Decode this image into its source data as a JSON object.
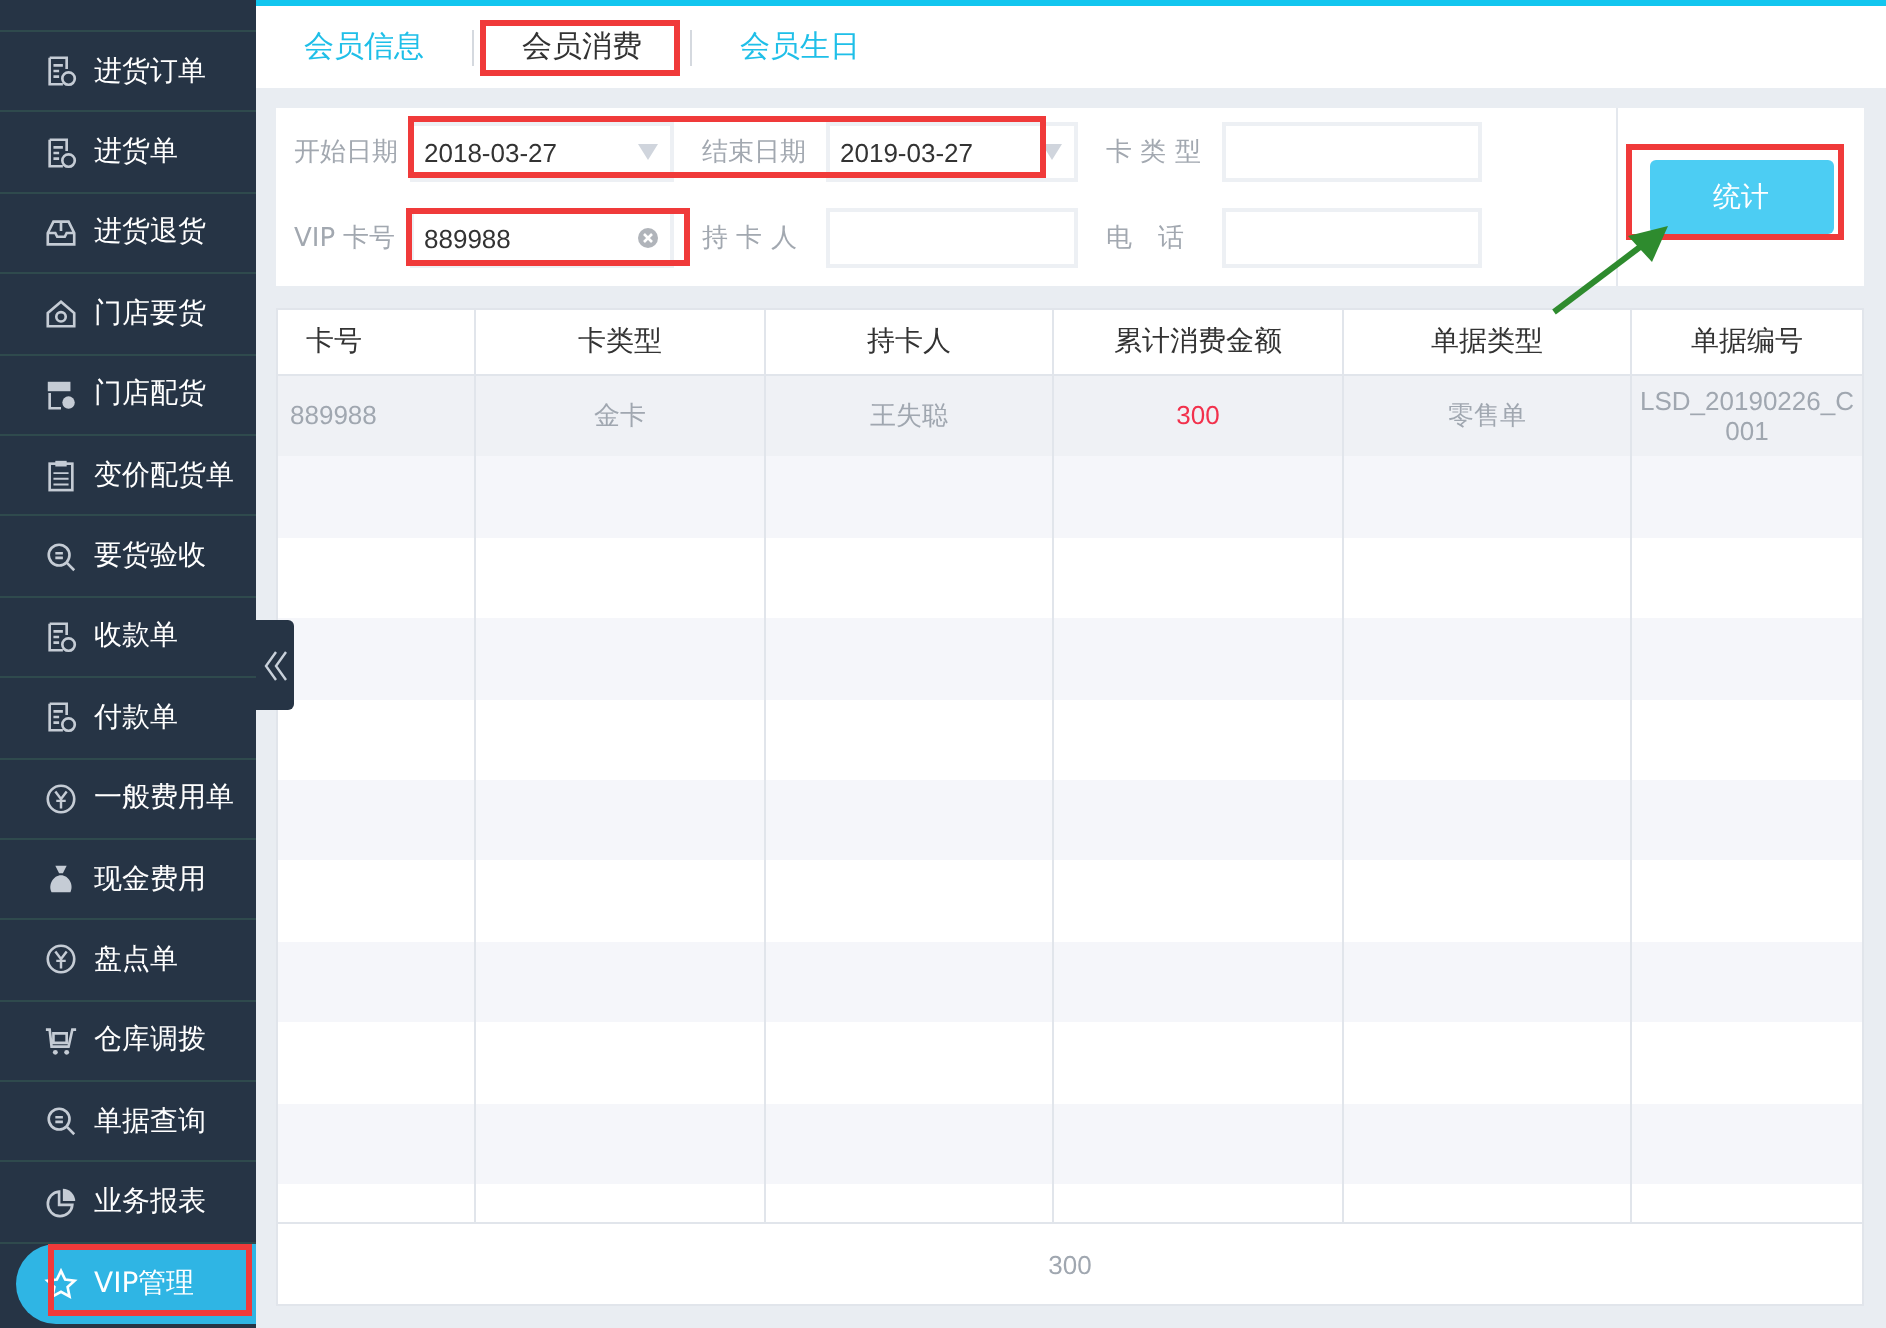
{
  "sidebar": {
    "items": [
      {
        "label": "进货订单",
        "selected": false
      },
      {
        "label": "进货单",
        "selected": false
      },
      {
        "label": "进货退货",
        "selected": false
      },
      {
        "label": "门店要货",
        "selected": false
      },
      {
        "label": "门店配货",
        "selected": false
      },
      {
        "label": "变价配货单",
        "selected": false
      },
      {
        "label": "要货验收",
        "selected": false
      },
      {
        "label": "收款单",
        "selected": false
      },
      {
        "label": "付款单",
        "selected": false
      },
      {
        "label": "一般费用单",
        "selected": false
      },
      {
        "label": "现金费用",
        "selected": false
      },
      {
        "label": "盘点单",
        "selected": false
      },
      {
        "label": "仓库调拨",
        "selected": false
      },
      {
        "label": "单据查询",
        "selected": false
      },
      {
        "label": "业务报表",
        "selected": false
      },
      {
        "label": "VIP管理",
        "selected": true
      }
    ]
  },
  "tabs": [
    {
      "label": "会员信息",
      "selected": false
    },
    {
      "label": "会员消费",
      "selected": true
    },
    {
      "label": "会员生日",
      "selected": false
    }
  ],
  "filters": [
    {
      "label": "开始日期",
      "kind": "date",
      "value": "2018-03-27"
    },
    {
      "label": "结束日期",
      "kind": "date",
      "value": "2019-03-27"
    },
    {
      "label": "卡 类 型",
      "kind": "text"
    },
    {
      "label": "VIP 卡号",
      "kind": "clearable",
      "value": "889988"
    },
    {
      "label": "持 卡 人",
      "kind": "text"
    },
    {
      "label": "电　话",
      "kind": "text"
    }
  ],
  "stats_button": "统计",
  "table": {
    "columns": [
      "卡号",
      "卡类型",
      "持卡人",
      "累计消费金额",
      "单据类型",
      "单据编号"
    ],
    "rows": [
      {
        "selected": true,
        "cells": [
          "889988",
          "金卡",
          "王失聪",
          "300",
          "零售单",
          "LSD_20190226_C001"
        ]
      }
    ],
    "footer": "300"
  }
}
